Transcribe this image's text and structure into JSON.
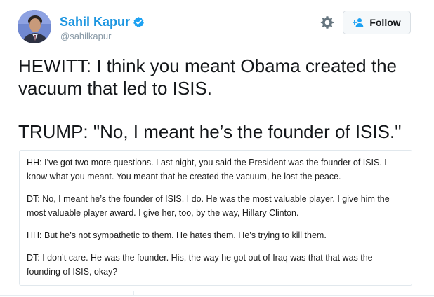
{
  "author": {
    "name": "Sahil Kapur",
    "handle": "@sahilkapur",
    "verified": true,
    "avatar_icon": "profile-photo"
  },
  "actions": {
    "settings_icon": "gear-icon",
    "follow_icon": "add-user-icon",
    "follow_label": "Follow"
  },
  "tweet": {
    "line1": "HEWITT: I think you meant Obama created the vacuum that led to ISIS.",
    "line2": "TRUMP: \"No, I meant he’s the founder of ISIS.\""
  },
  "transcript": {
    "paragraphs": [
      "HH: I’ve got two more questions. Last night, you said the President was the founder of ISIS. I know what you meant. You meant that he created the vacuum, he lost the peace.",
      "DT: No, I meant he’s the founder of ISIS. I do. He was the most valuable player. I give him the most valuable player award. I give her, too, by the way, Hillary Clinton.",
      "HH: But he’s not sympathetic to them. He hates them. He’s trying to kill them.",
      "DT: I don’t care. He was the founder. His, the way he got out of Iraq was that that was the founding of ISIS, okay?"
    ]
  },
  "colors": {
    "link_blue": "#1b95e0",
    "handle_gray": "#8899a6",
    "verified_blue": "#1da1f2",
    "border": "#e1e8ed"
  }
}
